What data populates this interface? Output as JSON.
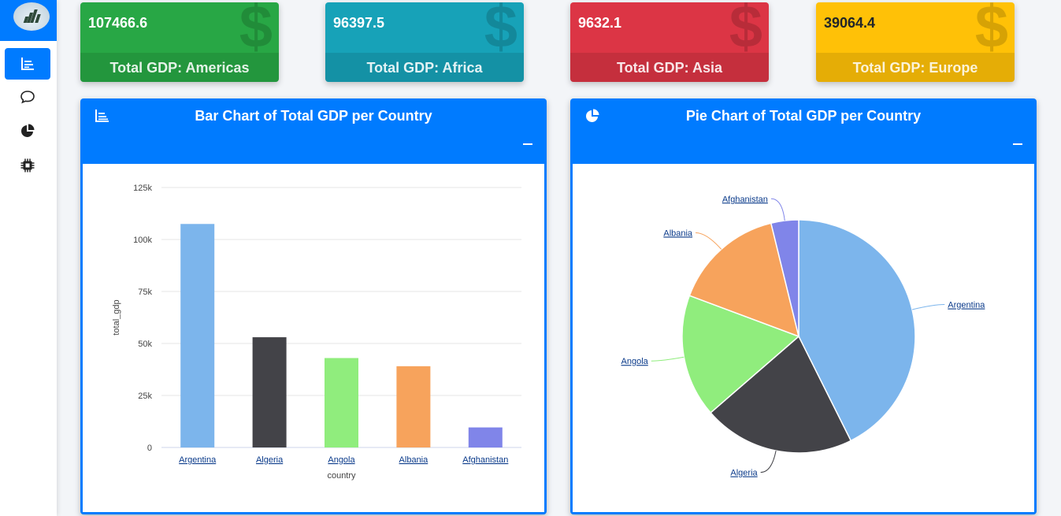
{
  "sidebar": {
    "logo": "logo-icon",
    "items": [
      {
        "icon": "bar-chart-icon",
        "active": true
      },
      {
        "icon": "chat-bubble-icon",
        "active": false
      },
      {
        "icon": "pie-chart-icon",
        "active": false
      },
      {
        "icon": "cpu-chip-icon",
        "active": false
      }
    ]
  },
  "cards": [
    {
      "value": "107466.6",
      "label": "Total GDP: Americas",
      "color": "#28a745",
      "icon": "dollar-icon",
      "symbol": "$"
    },
    {
      "value": "96397.5",
      "label": "Total GDP: Africa",
      "color": "#17a2b8",
      "icon": "dollar-icon",
      "symbol": "$"
    },
    {
      "value": "9632.1",
      "label": "Total GDP: Asia",
      "color": "#dc3545",
      "icon": "dollar-icon",
      "symbol": "$"
    },
    {
      "value": "39064.4",
      "label": "Total GDP: Europe",
      "color": "#ffc107",
      "icon": "dollar-icon",
      "symbol": "$"
    }
  ],
  "panels": {
    "bar": {
      "title": "Bar Chart of Total GDP per Country",
      "icon": "bar-chart-icon"
    },
    "pie": {
      "title": "Pie Chart of Total GDP per Country",
      "icon": "pie-chart-icon"
    }
  },
  "colors": {
    "primary": "#007bff"
  },
  "chart_data": [
    {
      "type": "bar",
      "categories": [
        "Argentina",
        "Algeria",
        "Angola",
        "Albania",
        "Afghanistan"
      ],
      "values": [
        107466.6,
        53000,
        43000,
        39064.4,
        9632.1
      ],
      "colors": [
        "#7cb5ec",
        "#434348",
        "#90ed7d",
        "#f7a35c",
        "#8085e9"
      ],
      "xlabel": "country",
      "ylabel": "total_gdp",
      "ylim": [
        0,
        125000
      ],
      "yticks": [
        0,
        25000,
        50000,
        75000,
        100000,
        125000
      ],
      "ytick_labels": [
        "0",
        "25k",
        "50k",
        "75k",
        "100k",
        "125k"
      ],
      "grid": true
    },
    {
      "type": "pie",
      "categories": [
        "Argentina",
        "Algeria",
        "Angola",
        "Albania",
        "Afghanistan"
      ],
      "values": [
        107466.6,
        53000,
        43000,
        39064.4,
        9632.1
      ],
      "colors": [
        "#7cb5ec",
        "#434348",
        "#90ed7d",
        "#f7a35c",
        "#8085e9"
      ]
    }
  ]
}
